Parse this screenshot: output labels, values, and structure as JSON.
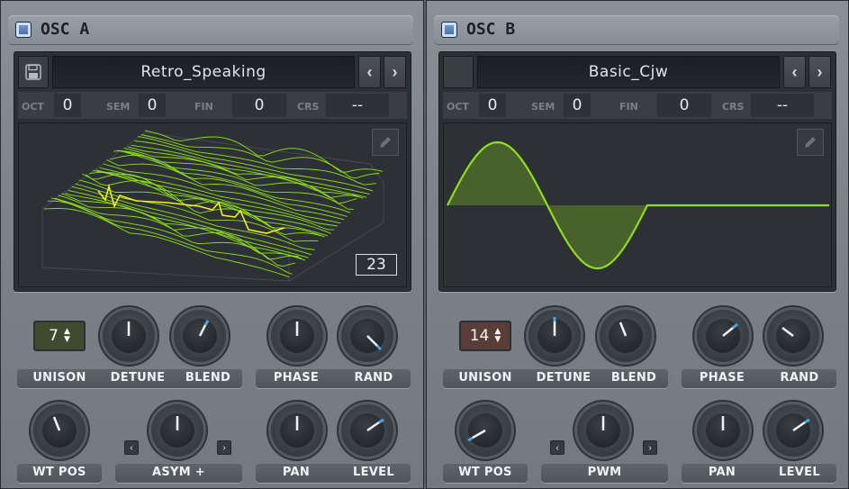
{
  "osc_a": {
    "title": "OSC A",
    "preset": "Retro_Speaking",
    "prev_arrow": "‹",
    "next_arrow": "›",
    "tuning": [
      {
        "label": "OCT",
        "value": "0"
      },
      {
        "label": "SEM",
        "value": "0"
      },
      {
        "label": "FIN",
        "value": "0"
      },
      {
        "label": "CRS",
        "value": "--"
      }
    ],
    "wavetable_frame": "23",
    "unison": "7",
    "labels": {
      "unison": "UNISON",
      "detune": "DETUNE",
      "blend": "BLEND",
      "phase": "PHASE",
      "rand": "RAND",
      "wt_pos": "WT POS",
      "warp": "ASYM +",
      "pan": "PAN",
      "level": "LEVEL"
    }
  },
  "osc_b": {
    "title": "OSC B",
    "preset": "Basic_Cjw",
    "prev_arrow": "‹",
    "next_arrow": "›",
    "tuning": [
      {
        "label": "OCT",
        "value": "0"
      },
      {
        "label": "SEM",
        "value": "0"
      },
      {
        "label": "FIN",
        "value": "0"
      },
      {
        "label": "CRS",
        "value": "--"
      }
    ],
    "unison": "14",
    "labels": {
      "unison": "UNISON",
      "detune": "DETUNE",
      "blend": "BLEND",
      "phase": "PHASE",
      "rand": "RAND",
      "wt_pos": "WT POS",
      "warp": "PWM",
      "pan": "PAN",
      "level": "LEVEL"
    }
  },
  "colors": {
    "wave_green": "#8fe01a",
    "wave_yellow": "#f2f01e",
    "indicator_blue": "#4fa6e6",
    "stepper_a": "#3f4a2e",
    "stepper_b": "#5a3c38"
  },
  "icons": {
    "enable": "enable-toggle-icon",
    "save": "save-icon",
    "edit": "pencil-icon",
    "prev": "chevron-left-icon",
    "next": "chevron-right-icon"
  }
}
